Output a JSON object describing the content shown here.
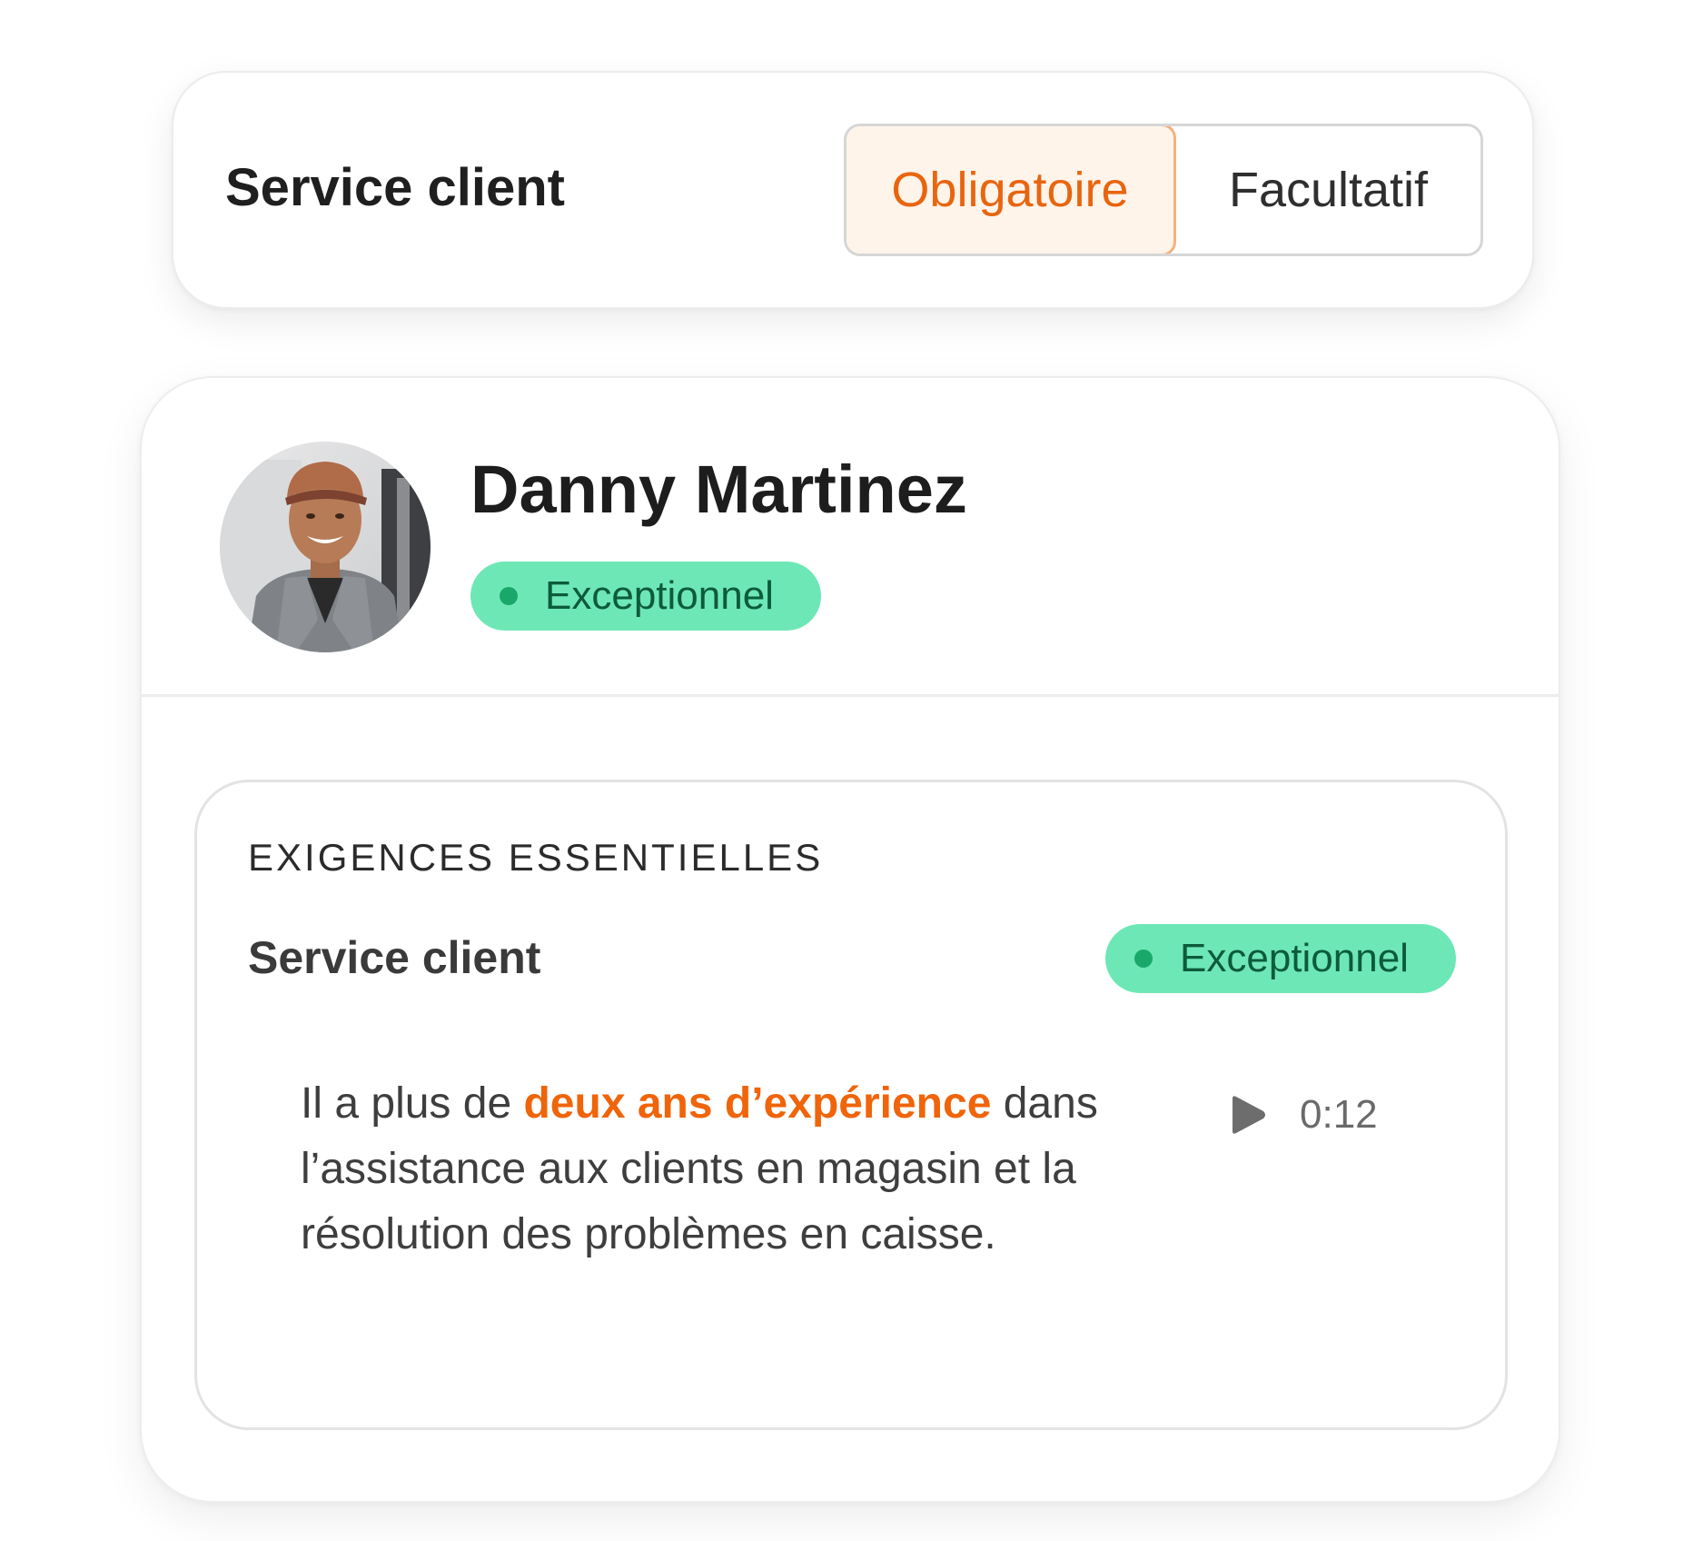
{
  "top_card": {
    "title": "Service client",
    "toggle": {
      "options": [
        "Obligatoire",
        "Facultatif"
      ],
      "selected": "Obligatoire"
    }
  },
  "candidate": {
    "name": "Danny Martinez",
    "rating_badge": "Exceptionnel"
  },
  "requirements": {
    "heading": "EXIGENCES ESSENTIELLES",
    "item": {
      "title": "Service client",
      "rating_badge": "Exceptionnel",
      "quote_before": "Il a plus de ",
      "quote_highlight": "deux ans d’expérience",
      "quote_after": " dans l’assistance aux clients en magasin et la résolution des problèmes en caisse.",
      "audio_duration": "0:12"
    }
  },
  "colors": {
    "accent_orange": "#e8650f",
    "badge_green": "#6ee7b6",
    "badge_dot": "#1aa86a"
  },
  "icons": {
    "avatar": "person-photo",
    "play": "play-icon",
    "badge_dot": "status-dot-icon"
  }
}
